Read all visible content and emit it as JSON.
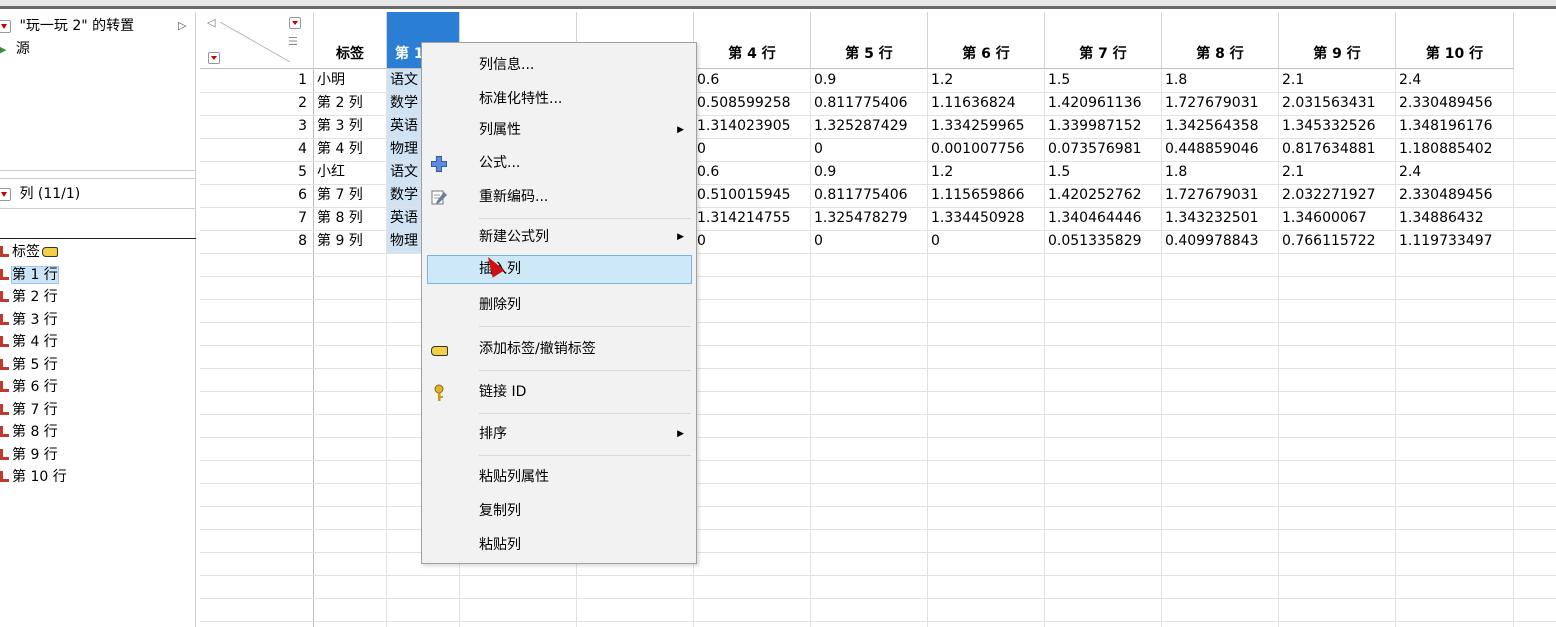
{
  "left_panel": {
    "table_title": "\"玩一玩 2\" 的转置",
    "source_label": "源",
    "columns_header": "列 (11/1)",
    "column_items": [
      {
        "label": "标签",
        "tag": true
      },
      {
        "label": "第 1 行",
        "selected": true
      },
      {
        "label": "第 2 行"
      },
      {
        "label": "第 3 行"
      },
      {
        "label": "第 4 行"
      },
      {
        "label": "第 5 行"
      },
      {
        "label": "第 6 行"
      },
      {
        "label": "第 7 行"
      },
      {
        "label": "第 8 行"
      },
      {
        "label": "第 9 行"
      },
      {
        "label": "第 10 行"
      }
    ]
  },
  "grid": {
    "headers": [
      "标签",
      "第 1",
      "",
      "",
      "第 4 行",
      "第 5 行",
      "第 6 行",
      "第 7 行",
      "第 8 行",
      "第 9 行",
      "第 10 行"
    ],
    "rows": [
      {
        "num": "1",
        "label": "小明",
        "col1": "语文",
        "values": [
          "0.6",
          "0.9",
          "1.2",
          "1.5",
          "1.8",
          "2.1",
          "2.4"
        ]
      },
      {
        "num": "2",
        "label": "第 2 列",
        "col1": "数学",
        "values": [
          "0.508599258",
          "0.811775406",
          "1.11636824",
          "1.420961136",
          "1.727679031",
          "2.031563431",
          "2.330489456"
        ]
      },
      {
        "num": "3",
        "label": "第 3 列",
        "col1": "英语",
        "values": [
          "1.314023905",
          "1.325287429",
          "1.334259965",
          "1.339987152",
          "1.342564358",
          "1.345332526",
          "1.348196176"
        ]
      },
      {
        "num": "4",
        "label": "第 4 列",
        "col1": "物理",
        "values": [
          "0",
          "0",
          "0.001007756",
          "0.073576981",
          "0.448859046",
          "0.817634881",
          "1.180885402"
        ]
      },
      {
        "num": "5",
        "label": "小红",
        "col1": "语文",
        "values": [
          "0.6",
          "0.9",
          "1.2",
          "1.5",
          "1.8",
          "2.1",
          "2.4"
        ]
      },
      {
        "num": "6",
        "label": "第 7 列",
        "col1": "数学",
        "values": [
          "0.510015945",
          "0.811775406",
          "1.115659866",
          "1.420252762",
          "1.727679031",
          "2.032271927",
          "2.330489456"
        ]
      },
      {
        "num": "7",
        "label": "第 8 列",
        "col1": "英语",
        "values": [
          "1.314214755",
          "1.325478279",
          "1.334450928",
          "1.340464446",
          "1.343232501",
          "1.34600067",
          "1.34886432"
        ]
      },
      {
        "num": "8",
        "label": "第 9 列",
        "col1": "物理",
        "values": [
          "0",
          "0",
          "0",
          "0.051335829",
          "0.409978843",
          "0.766115722",
          "1.119733497"
        ]
      }
    ]
  },
  "context_menu": {
    "items": [
      {
        "label": "列信息...",
        "icon": null
      },
      {
        "label": "标准化特性...",
        "icon": null
      },
      {
        "label": "列属性",
        "submenu": true
      },
      {
        "label": "公式...",
        "icon": "plus-cross-icon"
      },
      {
        "label": "重新编码...",
        "icon": "pencil-edit-icon"
      },
      {
        "label": "新建公式列",
        "submenu": true
      },
      {
        "label": "插入列",
        "highlighted": true
      },
      {
        "label": "删除列"
      },
      {
        "label": "添加标签/撤销标签",
        "icon": "tag-icon"
      },
      {
        "label": "链接 ID",
        "icon": "key-icon"
      },
      {
        "label": "排序",
        "submenu": true
      },
      {
        "label": "粘贴列属性"
      },
      {
        "label": "复制列"
      },
      {
        "label": "粘贴列"
      }
    ]
  },
  "colors": {
    "selected_header": "#2a7fd4",
    "selected_cell": "#cfe3f5",
    "menu_highlight": "#cde8f7",
    "cursor": "#d01010"
  }
}
